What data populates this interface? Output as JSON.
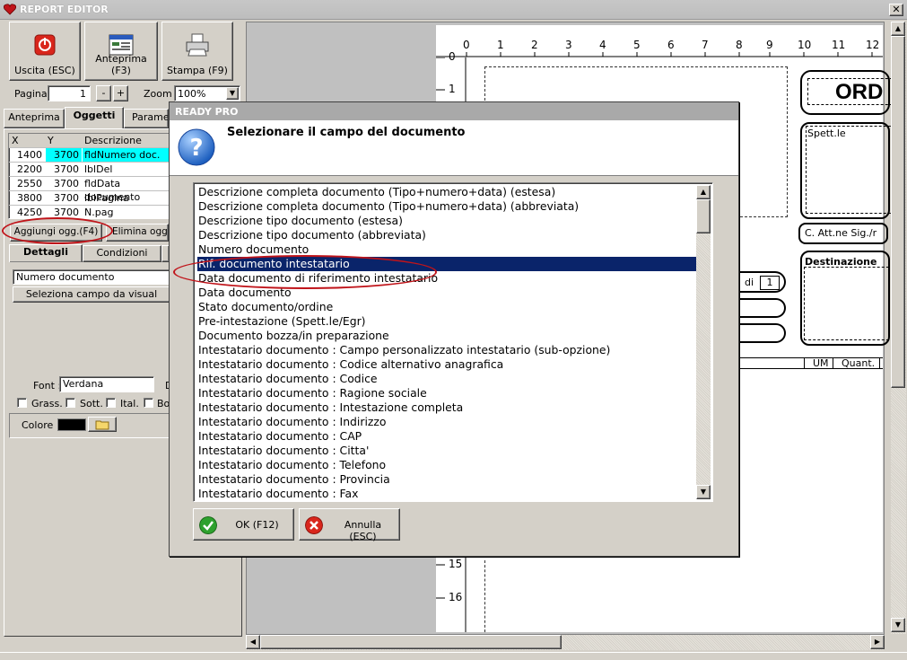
{
  "window": {
    "title": "REPORT EDITOR",
    "close_glyph": "✕"
  },
  "toolbar": {
    "exit_label": "Uscita (ESC)",
    "preview_label": "Anteprima (F3)",
    "print_label": "Stampa (F9)"
  },
  "paging": {
    "page_label": "Pagina",
    "page_value": "1",
    "minus": "-",
    "plus": "+",
    "zoom_label": "Zoom",
    "zoom_value": "100%"
  },
  "tabs": {
    "preview": "Anteprima",
    "objects": "Oggetti",
    "params": "Paramet"
  },
  "grid": {
    "headers": [
      "X",
      "Y",
      "Descrizione"
    ],
    "rows": [
      [
        "1400",
        "3700",
        "fldNumero doc."
      ],
      [
        "2200",
        "3700",
        "lblDel"
      ],
      [
        "2550",
        "3700",
        "fldData documento"
      ],
      [
        "3800",
        "3700",
        "lblPagina"
      ],
      [
        "4250",
        "3700",
        "N.pag"
      ]
    ]
  },
  "actions": {
    "add_object": "Aggiungi ogg.(F4)",
    "delete_object": "Elimina ogget"
  },
  "subtabs": {
    "details": "Dettagli",
    "conditions": "Condizioni"
  },
  "details": {
    "field_value": "Numero documento",
    "select_field_button": "Seleziona campo da visual"
  },
  "font": {
    "label": "Font :",
    "value": "Verdana",
    "size_partial": "D",
    "bold": "Grass.",
    "underline": "Sott.",
    "italic": "Ital.",
    "border_partial": "Bo",
    "color_label": "Colore :"
  },
  "ruler": {
    "top": [
      "0",
      "1",
      "2",
      "3",
      "4",
      "5",
      "6",
      "7",
      "8",
      "9",
      "10",
      "11",
      "12"
    ],
    "left_top": [
      "0",
      "1"
    ],
    "left_bottom": [
      "15",
      "16"
    ]
  },
  "report": {
    "title_partial": "ORD",
    "spett": "Spett.le",
    "att": "C. Att.ne Sig./r",
    "dest": "Destinazione",
    "di": "di",
    "di_value": "1",
    "um": "UM",
    "quant": "Quant."
  },
  "dialog": {
    "title": "READY PRO",
    "heading": "Selezionare il campo del documento",
    "items": [
      "Descrizione completa documento (Tipo+numero+data) (estesa)",
      "Descrizione completa documento (Tipo+numero+data) (abbreviata)",
      "Descrizione tipo documento (estesa)",
      "Descrizione tipo documento (abbreviata)",
      "Numero documento",
      "Rif. documento intestatario",
      "Data documento di riferimento intestatario",
      "Data documento",
      "Stato documento/ordine",
      "Pre-intestazione (Spett.le/Egr)",
      "Documento bozza/in preparazione",
      "Intestatario documento : Campo personalizzato intestatario (sub-opzione)",
      "Intestatario documento : Codice alternativo anagrafica",
      "Intestatario documento : Codice",
      "Intestatario documento : Ragione sociale",
      "Intestatario documento : Intestazione completa",
      "Intestatario documento : Indirizzo",
      "Intestatario documento : CAP",
      "Intestatario documento : Citta'",
      "Intestatario documento : Telefono",
      "Intestatario documento : Provincia",
      "Intestatario documento : Fax"
    ],
    "selected_index": 5,
    "ok_label": "OK (F12)",
    "cancel_label": "Annulla (ESC)"
  },
  "colors": {
    "selection": "#0a246a",
    "highlight_cell": "#00ffff",
    "annotation": "#c0141a"
  }
}
